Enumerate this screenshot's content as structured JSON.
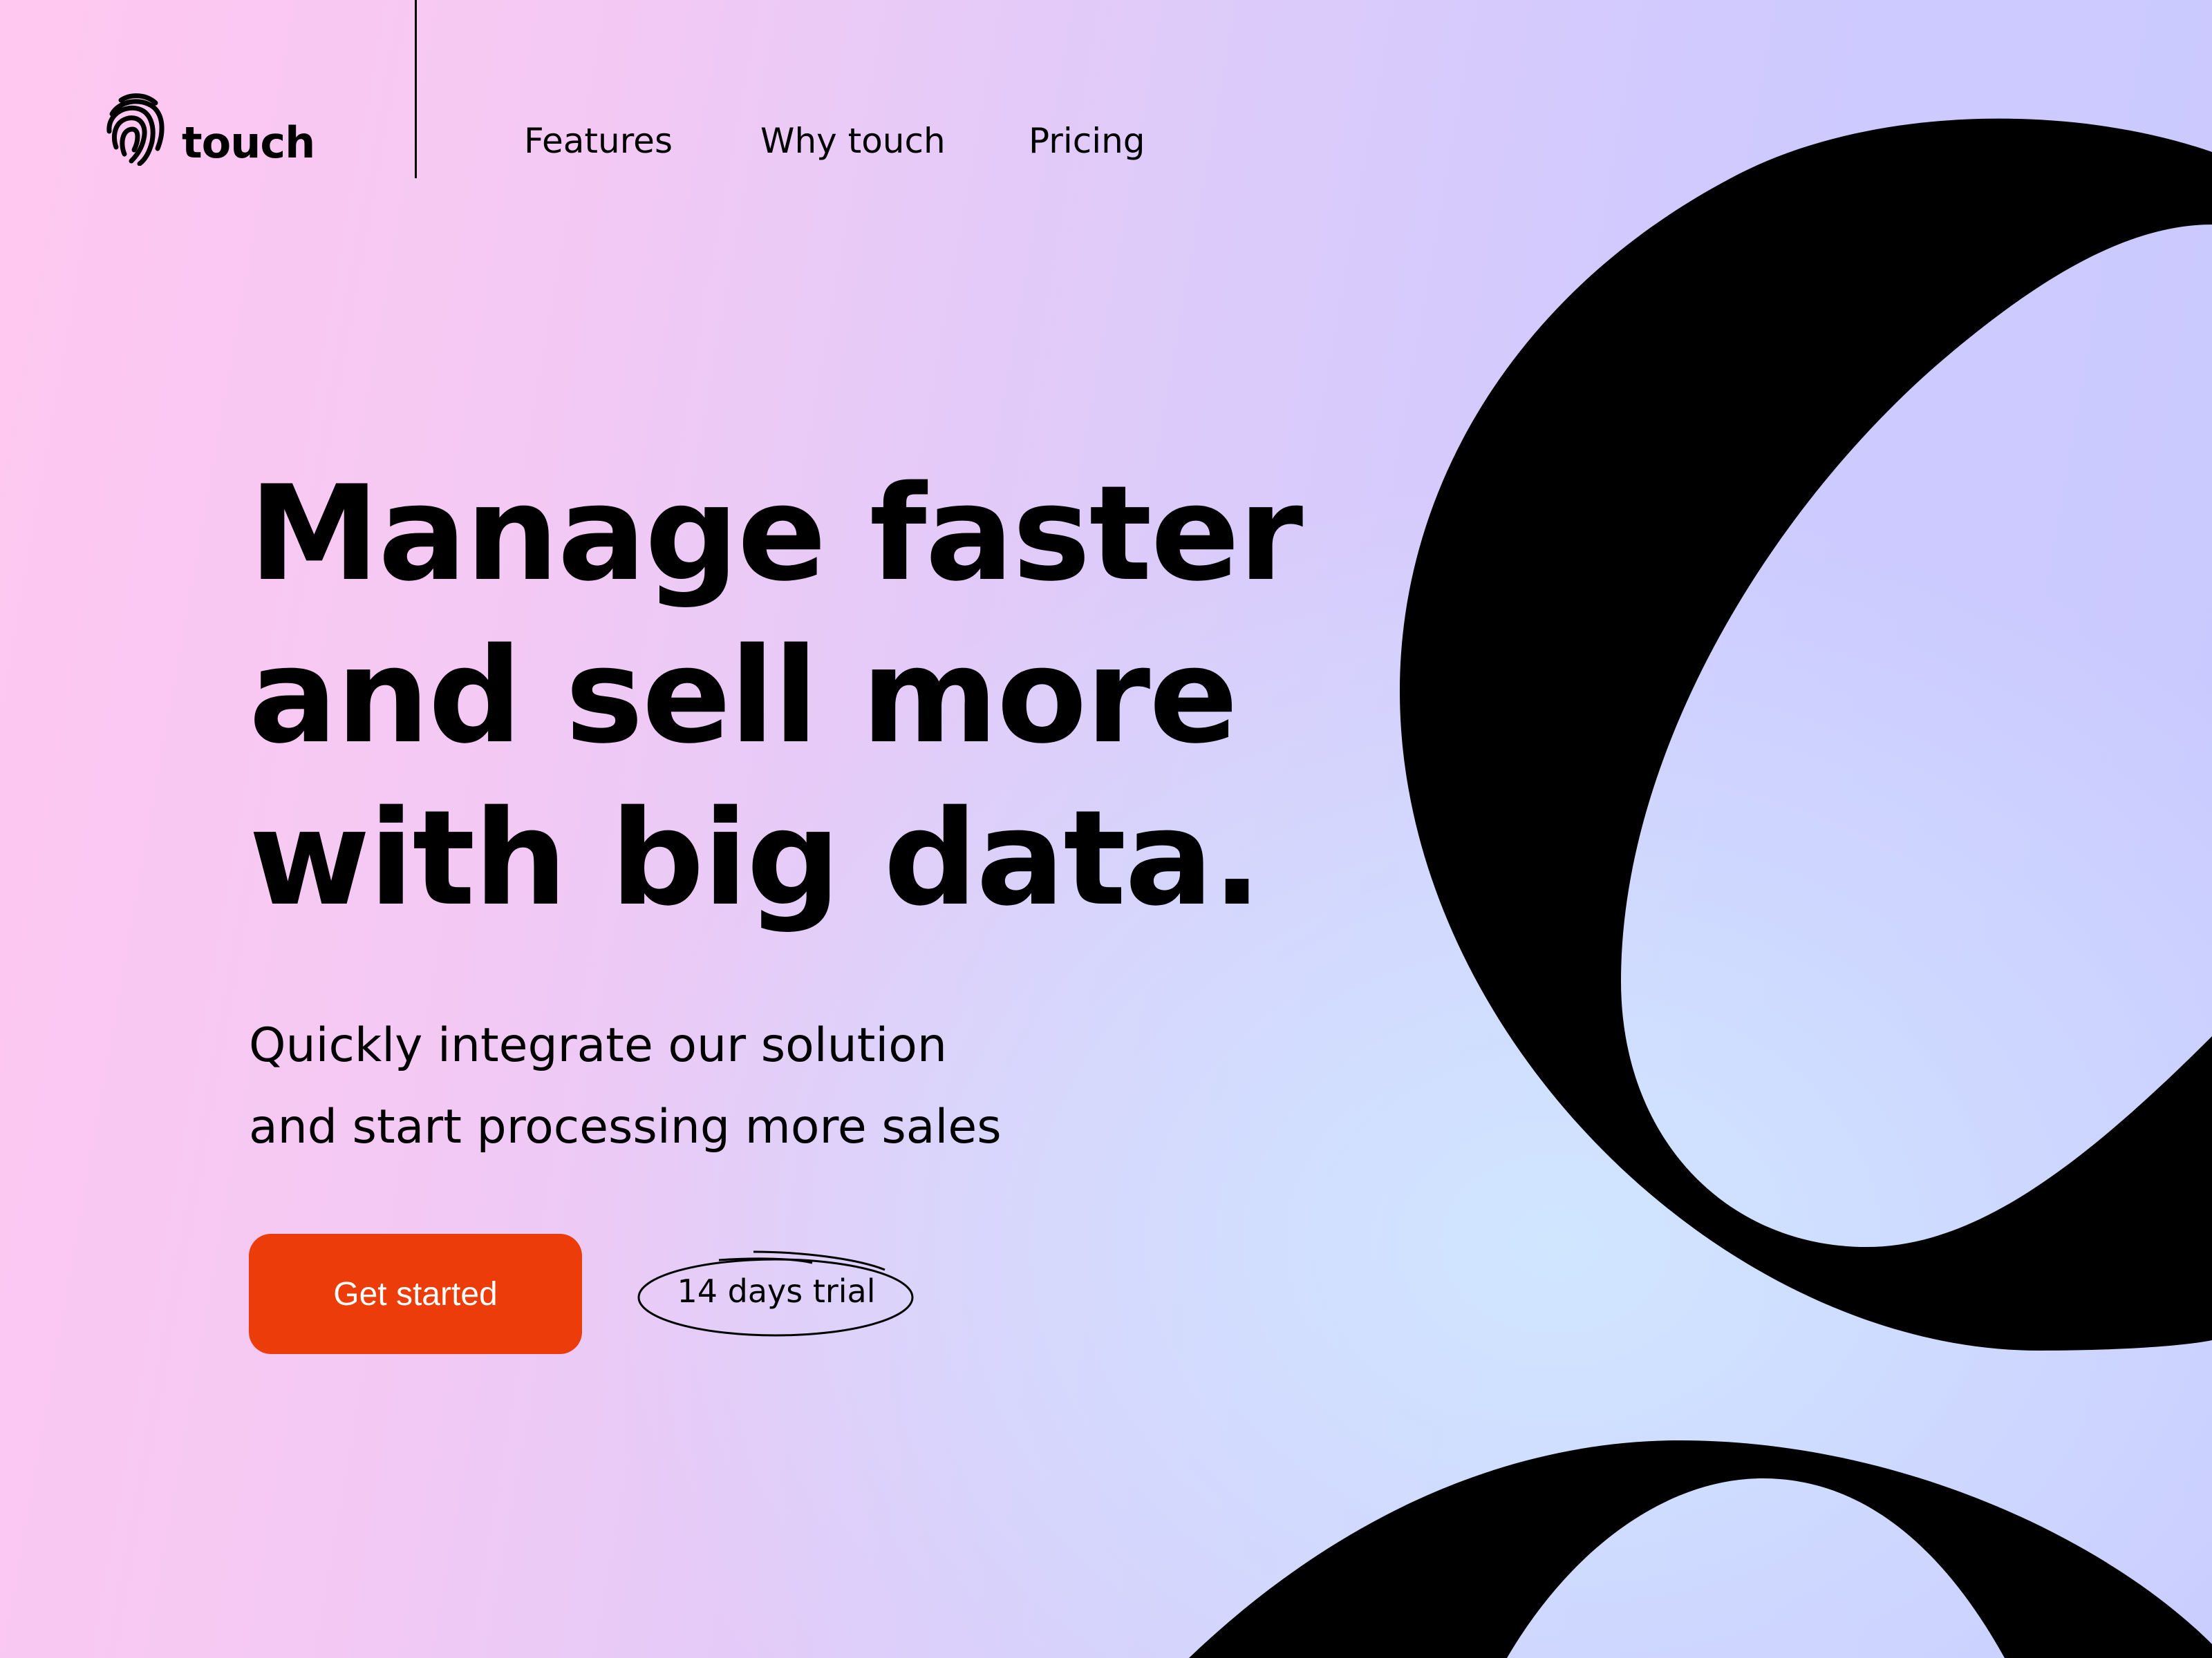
{
  "brand": {
    "name": "touch",
    "icon": "fingerprint-icon"
  },
  "nav": {
    "items": [
      {
        "label": "Features"
      },
      {
        "label": "Why touch"
      },
      {
        "label": "Pricing"
      }
    ]
  },
  "hero": {
    "headline": [
      "Manage faster",
      "and sell more",
      "with big data."
    ],
    "subtitle": [
      "Quickly integrate our solution",
      "and start processing more sales"
    ],
    "cta_label": "Get started",
    "trial_label": "14 days trial"
  },
  "colors": {
    "accent": "#eb3c0a",
    "text": "#000000",
    "bg_pink": "#ffc8f0",
    "bg_violet": "#c9c9ff",
    "bg_blue": "#d0e6ff"
  }
}
